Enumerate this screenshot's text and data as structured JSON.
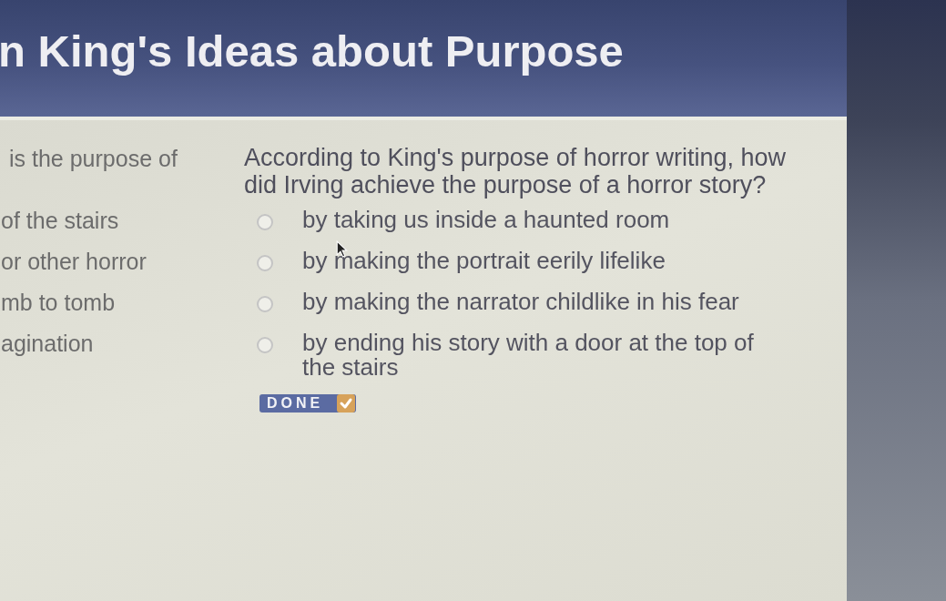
{
  "header": {
    "title": "n King's Ideas about Purpose"
  },
  "passage": {
    "heading": "is the purpose of",
    "lines": [
      "of the stairs",
      "or other horror",
      "mb to tomb",
      "agination"
    ]
  },
  "question": {
    "prompt": "According to King's purpose of horror writing, how did Irving achieve the purpose of a horror story?",
    "options": [
      {
        "text": "by taking us inside a haunted room",
        "selected": false
      },
      {
        "text": "by making the portrait eerily lifelike",
        "selected": false
      },
      {
        "text": "by making the narrator childlike in his fear",
        "selected": false
      },
      {
        "text": "by ending his story with a door at the top of the stairs",
        "selected": false
      }
    ]
  },
  "done_button": {
    "label": "DONE"
  }
}
